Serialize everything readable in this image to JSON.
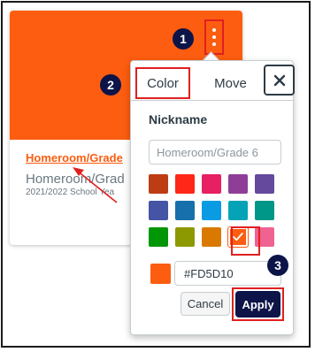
{
  "colors": {
    "brand_orange": "#FD5D10",
    "annotation_red": "#e02020",
    "navy": "#0c1448"
  },
  "card": {
    "title": "Homeroom/Grade",
    "subtitle": "Homeroom/Grad",
    "term": "2021/2022 School Yea",
    "options_icon": "kebab-vertical-icon"
  },
  "popover": {
    "tabs": [
      {
        "label": "Color",
        "selected": true
      },
      {
        "label": "Move",
        "selected": false
      }
    ],
    "close_icon": "close-icon",
    "nickname_label": "Nickname",
    "nickname_placeholder": "Homeroom/Grade 6",
    "swatches": [
      {
        "color": "#BD3C14",
        "selected": false
      },
      {
        "color": "#FF2717",
        "selected": false
      },
      {
        "color": "#E71F63",
        "selected": false
      },
      {
        "color": "#8F3E97",
        "selected": false
      },
      {
        "color": "#65499D",
        "selected": false
      },
      {
        "color": "#4554A4",
        "selected": false
      },
      {
        "color": "#1770AB",
        "selected": false
      },
      {
        "color": "#0B9BE3",
        "selected": false
      },
      {
        "color": "#06A3B7",
        "selected": false
      },
      {
        "color": "#009688",
        "selected": false
      },
      {
        "color": "#009606",
        "selected": false
      },
      {
        "color": "#8D9900",
        "selected": false
      },
      {
        "color": "#D97900",
        "selected": false
      },
      {
        "color": "#FD5D10",
        "selected": true
      },
      {
        "color": "#F06291",
        "selected": false
      }
    ],
    "hex_value": "#FD5D10",
    "cancel_label": "Cancel",
    "apply_label": "Apply"
  },
  "annotations": {
    "step1": "1",
    "step2": "2",
    "step3": "3"
  }
}
